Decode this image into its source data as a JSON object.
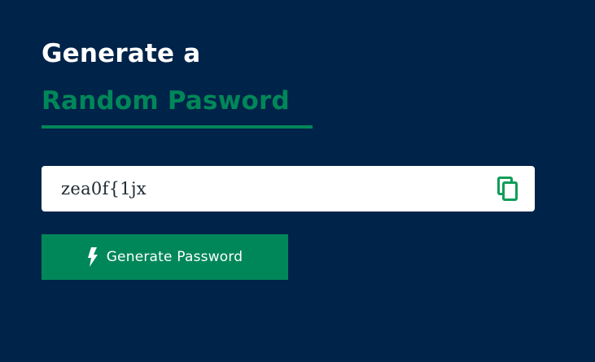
{
  "heading": {
    "line1": "Generate a",
    "line2": "Random Pasword"
  },
  "password_field": {
    "value": "zea0f{1jx",
    "copy_icon": "copy-icon"
  },
  "generate_button": {
    "label": "Generate Password",
    "icon": "bolt-icon"
  },
  "colors": {
    "background": "#002349",
    "accent": "#008759",
    "field_background": "#ffffff",
    "heading_text": "#ffffff"
  }
}
